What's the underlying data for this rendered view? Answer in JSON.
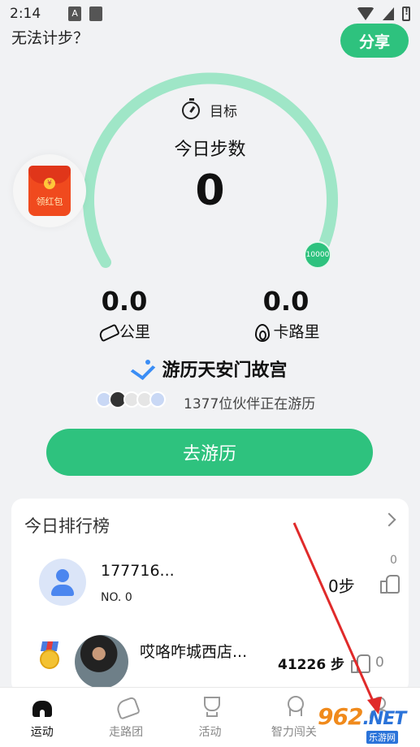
{
  "status_bar": {
    "time": "2:14",
    "icons": [
      "notification-a-icon",
      "square-icon",
      "wifi-icon",
      "signal-icon",
      "battery-alert-icon"
    ]
  },
  "header": {
    "cant_step_link": "无法计步？",
    "share_label": "分享"
  },
  "gauge": {
    "goal_label": "目标",
    "steps_title": "今日步数",
    "steps_value": "0",
    "goal_value": "10000",
    "progress_fraction": 0,
    "colors": {
      "track": "#9fe6c7",
      "accent": "#2ec27e"
    }
  },
  "red_packet": {
    "label": "领红包",
    "icon": "red-envelope-icon"
  },
  "stats": {
    "distance": {
      "value": "0.0",
      "label": "公里",
      "icon": "shoe-icon"
    },
    "calories": {
      "value": "0.0",
      "label": "卡路里",
      "icon": "fire-icon"
    }
  },
  "tour": {
    "title": "游历天安门故宫",
    "companions_text": "1377位伙伴正在游历",
    "button_label": "去游历"
  },
  "ranking": {
    "title": "今日排行榜",
    "rows": [
      {
        "name": "177716...",
        "rank": "NO. 0",
        "steps": "0步",
        "likes": "0"
      },
      {
        "name": "哎咯咋城西店...",
        "steps": "41226 步",
        "likes": "0"
      }
    ]
  },
  "bottom_nav": {
    "items": [
      {
        "label": "运动",
        "icon": "home-icon",
        "active": true
      },
      {
        "label": "走路团",
        "icon": "shoe-icon",
        "active": false
      },
      {
        "label": "活动",
        "icon": "trophy-icon",
        "active": false
      },
      {
        "label": "智力闯关",
        "icon": "award-icon",
        "active": false
      },
      {
        "label": "",
        "icon": "user-icon",
        "active": false
      }
    ]
  },
  "watermark": {
    "main": "962",
    "suffix": ".NET",
    "sub": "乐游网"
  }
}
